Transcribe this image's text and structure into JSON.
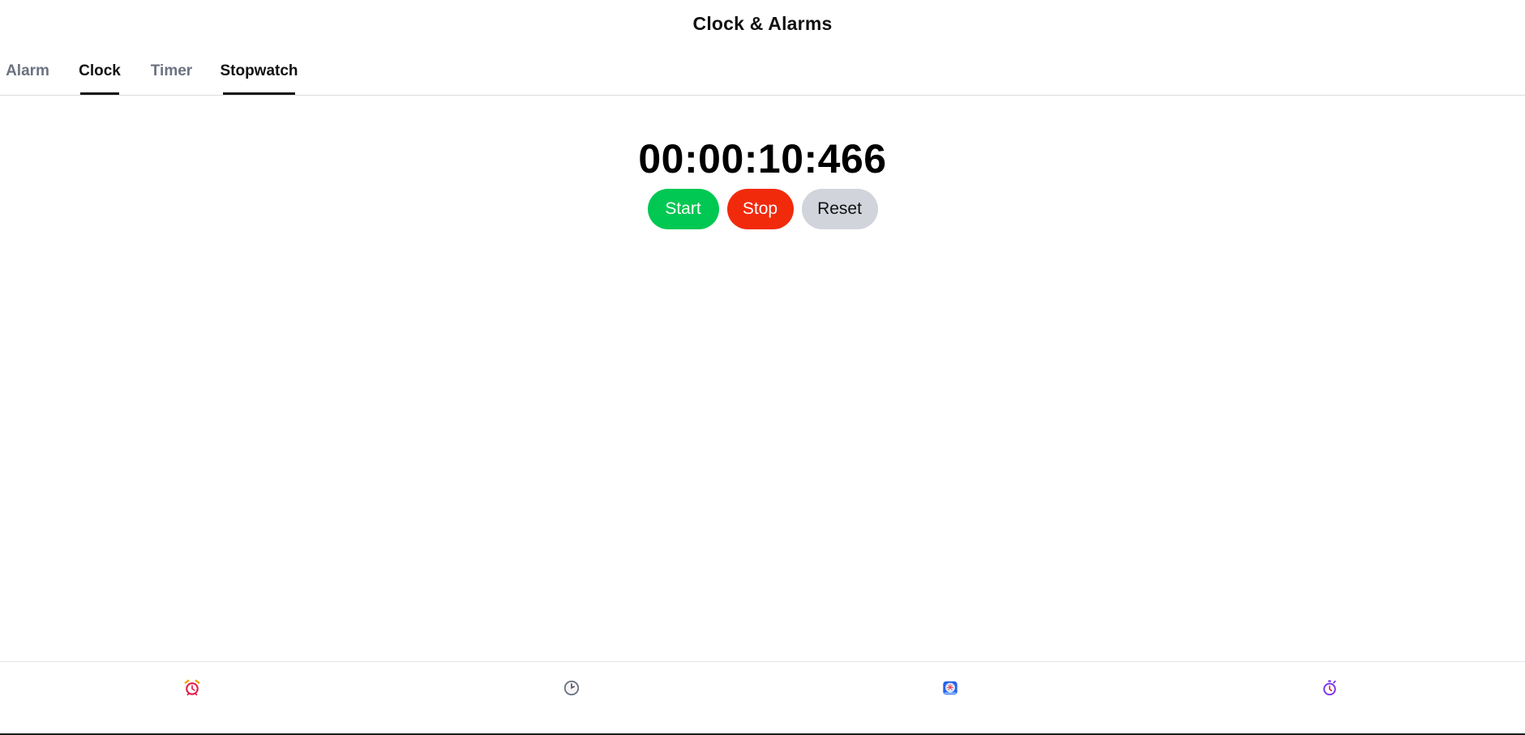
{
  "app": {
    "title": "Clock & Alarms"
  },
  "tabs": [
    {
      "label": "Alarm",
      "state": "inactive"
    },
    {
      "label": "Clock",
      "state": "active"
    },
    {
      "label": "Timer",
      "state": "inactive"
    },
    {
      "label": "Stopwatch",
      "state": "active"
    }
  ],
  "stopwatch": {
    "display": "00:00:10:466",
    "start_label": "Start",
    "stop_label": "Stop",
    "reset_label": "Reset"
  },
  "bottom_nav": [
    {
      "icon": "alarm-clock-icon"
    },
    {
      "icon": "clock-icon"
    },
    {
      "icon": "world-clock-icon"
    },
    {
      "icon": "stopwatch-icon"
    }
  ],
  "colors": {
    "start": "#00c853",
    "stop": "#f22a0c",
    "reset": "#d1d5db",
    "active_tab": "#111111",
    "inactive_tab": "#6b7280"
  }
}
